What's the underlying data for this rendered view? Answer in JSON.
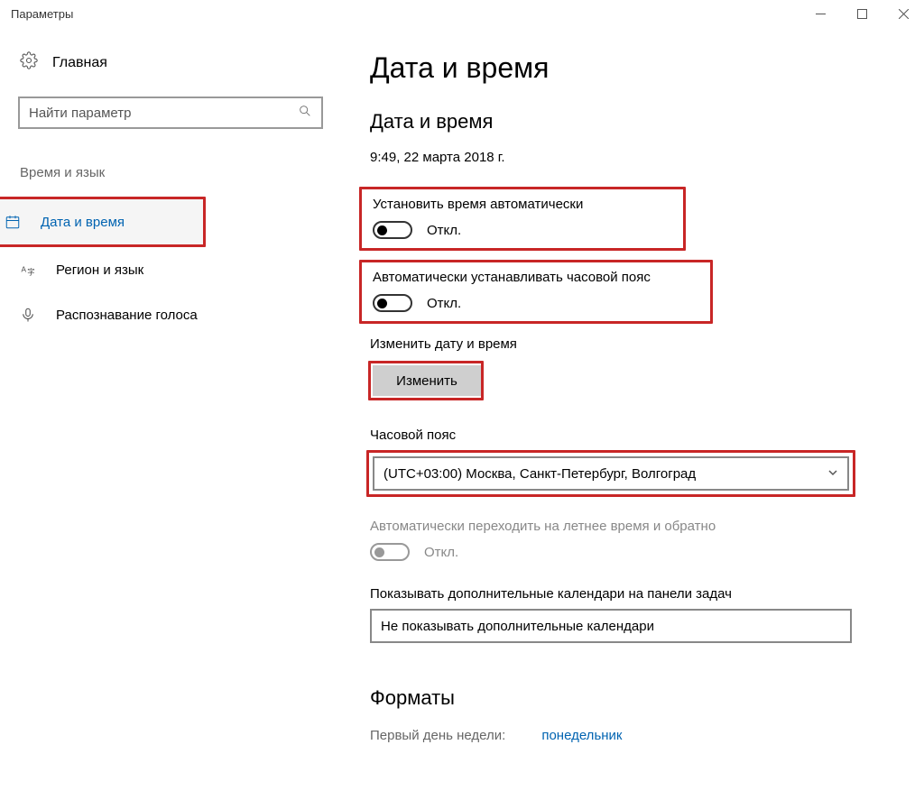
{
  "window": {
    "title": "Параметры"
  },
  "sidebar": {
    "home": "Главная",
    "search_placeholder": "Найти параметр",
    "section": "Время и язык",
    "items": [
      {
        "label": "Дата и время"
      },
      {
        "label": "Регион и язык"
      },
      {
        "label": "Распознавание голоса"
      }
    ]
  },
  "page": {
    "title": "Дата и время",
    "subhead": "Дата и время",
    "timestamp": "9:49, 22 марта 2018 г.",
    "auto_time": {
      "label": "Установить время автоматически",
      "state": "Откл."
    },
    "auto_tz": {
      "label": "Автоматически устанавливать часовой пояс",
      "state": "Откл."
    },
    "change_dt": {
      "label": "Изменить дату и время",
      "button": "Изменить"
    },
    "tz": {
      "label": "Часовой пояс",
      "value": "(UTC+03:00) Москва, Санкт-Петербург, Волгоград"
    },
    "dst": {
      "label": "Автоматически переходить на летнее время и обратно",
      "state": "Откл."
    },
    "calendars": {
      "label": "Показывать дополнительные календари на панели задач",
      "value": "Не показывать дополнительные календари"
    },
    "formats_head": "Форматы",
    "cutoff_label": "Первый день недели:",
    "cutoff_value": "понедельник"
  }
}
